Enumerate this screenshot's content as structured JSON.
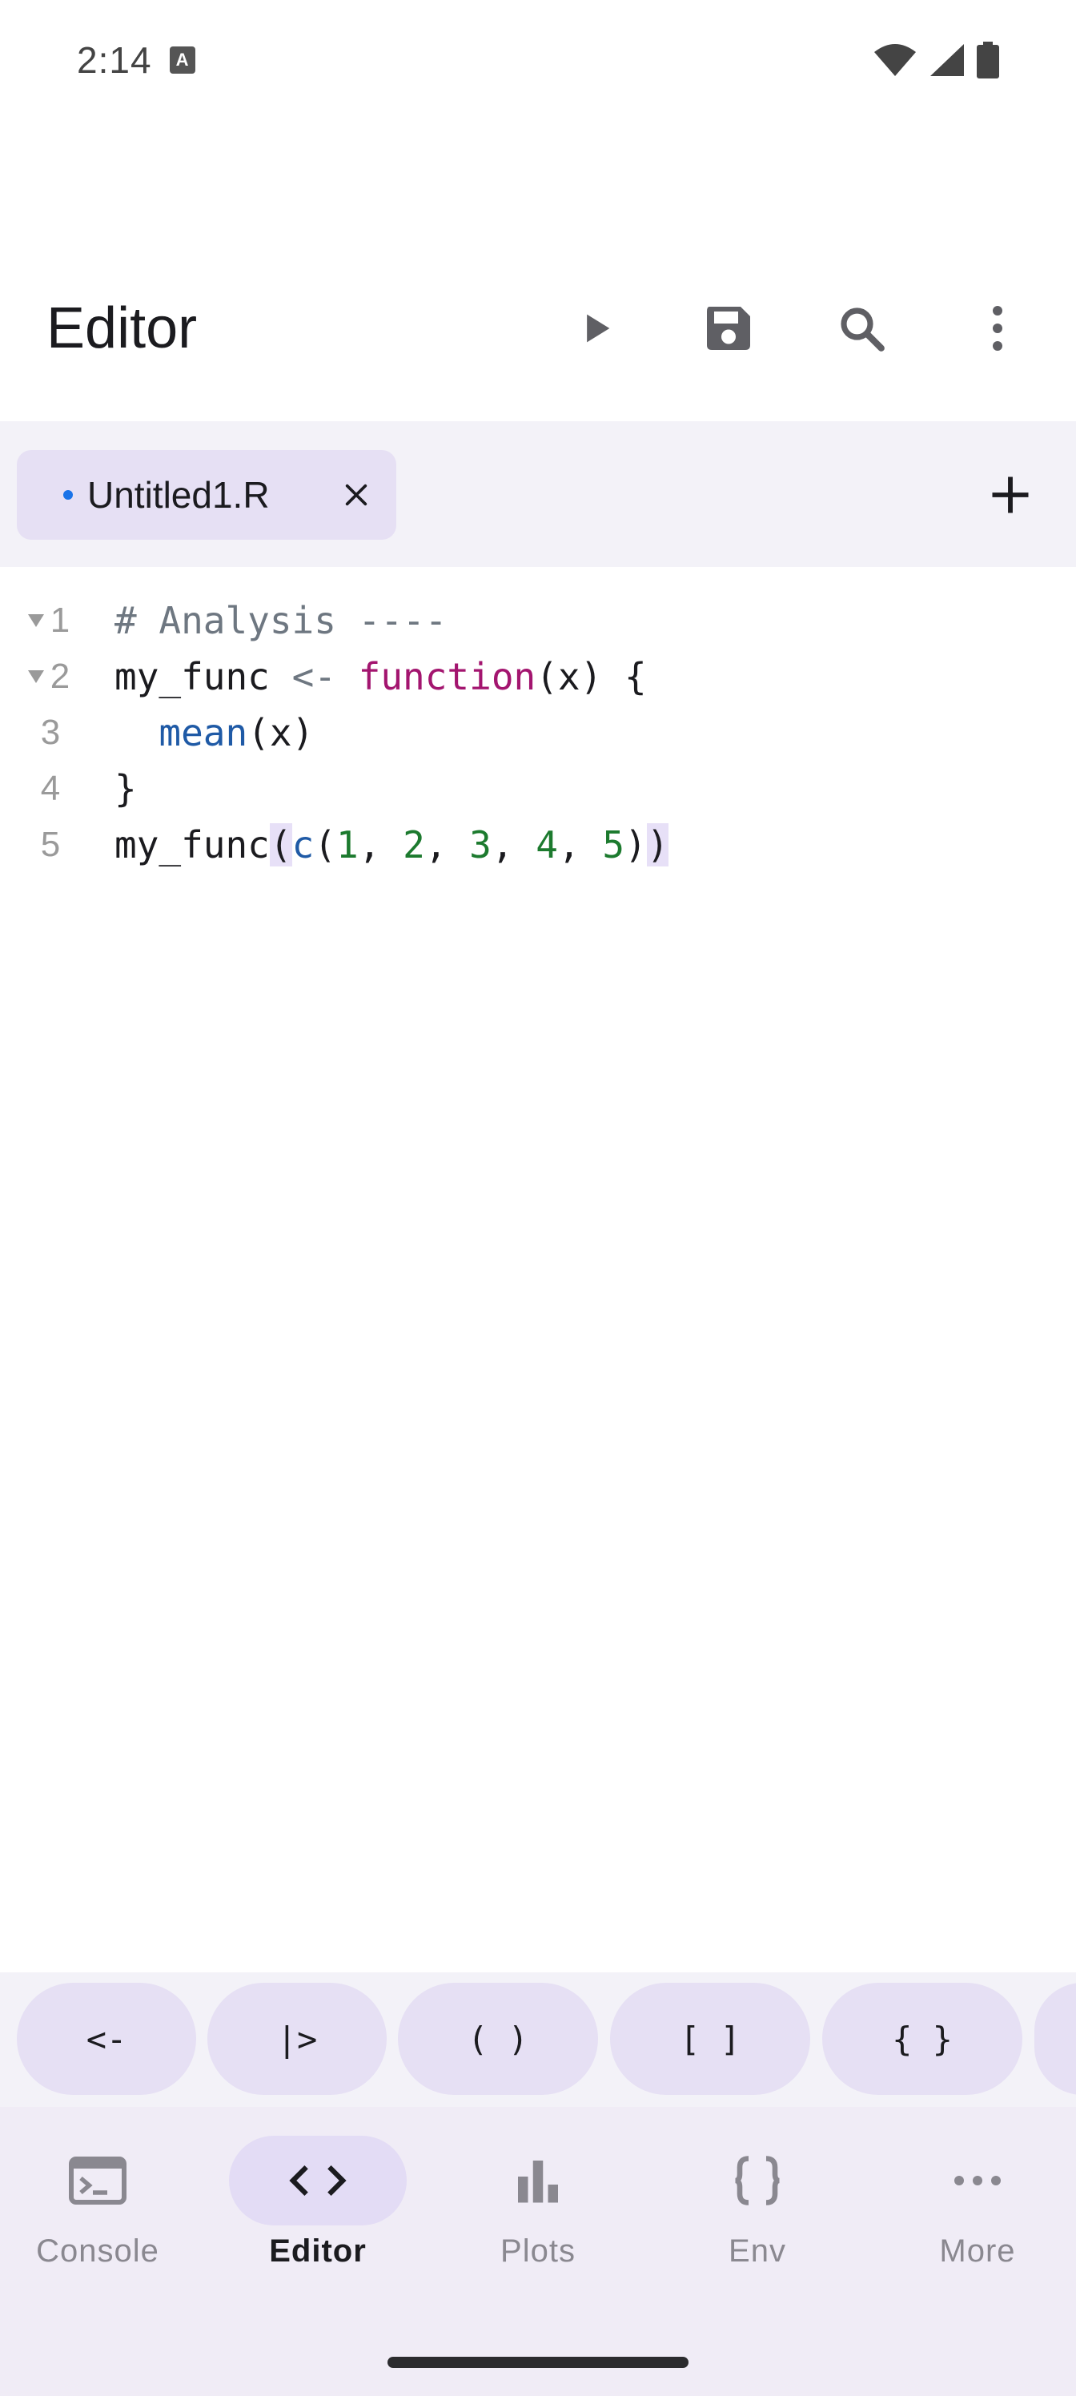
{
  "status_bar": {
    "time": "2:14",
    "notification_icon": "keyboard-a-icon",
    "icons": [
      "wifi-icon",
      "signal-icon",
      "battery-icon"
    ]
  },
  "app_bar": {
    "title": "Editor",
    "actions": [
      "run-icon",
      "save-icon",
      "search-icon",
      "more-vert-icon"
    ]
  },
  "tabs": {
    "items": [
      {
        "label": "Untitled1.R",
        "modified": true,
        "active": true
      }
    ],
    "add_icon": "plus-icon"
  },
  "editor": {
    "lines": [
      {
        "number": "1",
        "foldable": true,
        "text": "# Analysis ----"
      },
      {
        "number": "2",
        "foldable": true,
        "text": "my_func <- function(x) {"
      },
      {
        "number": "3",
        "foldable": false,
        "text": "  mean(x)"
      },
      {
        "number": "4",
        "foldable": false,
        "text": "}"
      },
      {
        "number": "5",
        "foldable": false,
        "text": "my_func(c(1, 2, 3, 4, 5))"
      }
    ],
    "colors": {
      "comment": "#6e7781",
      "keyword": "#a3156f",
      "function": "#1f5aa6",
      "number": "#1c7a2e",
      "bracket_highlight": "#e7e0f7"
    }
  },
  "symbol_bar": {
    "chips": [
      "<-",
      "|>",
      "( )",
      "[ ]",
      "{ }"
    ]
  },
  "bottom_nav": {
    "items": [
      {
        "label": "Console",
        "icon": "terminal-icon",
        "active": false
      },
      {
        "label": "Editor",
        "icon": "code-icon",
        "active": true
      },
      {
        "label": "Plots",
        "icon": "bar-chart-icon",
        "active": false
      },
      {
        "label": "Env",
        "icon": "braces-icon",
        "active": false
      },
      {
        "label": "More",
        "icon": "more-horiz-icon",
        "active": false
      }
    ]
  }
}
